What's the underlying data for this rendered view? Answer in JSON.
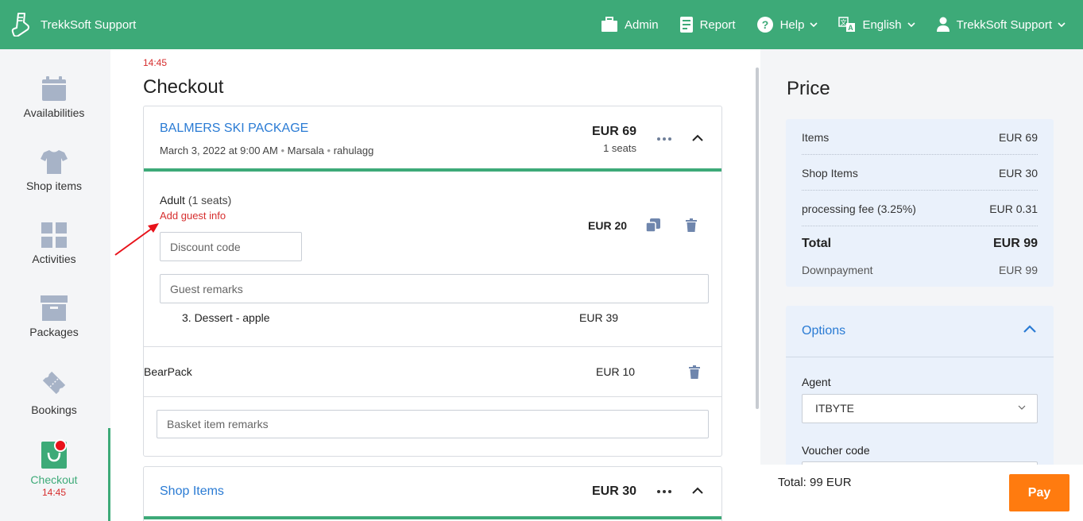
{
  "topbar": {
    "brand": "TrekkSoft Support",
    "nav": {
      "admin": "Admin",
      "report": "Report",
      "help": "Help",
      "language": "English",
      "user": "TrekkSoft Support"
    },
    "icons": [
      "boot-logo-icon",
      "briefcase-icon",
      "report-icon",
      "help-icon",
      "translate-icon",
      "user-icon",
      "chevron-down-icon"
    ]
  },
  "sidebar": {
    "items": [
      {
        "label": "Availabilities",
        "icon": "calendar-icon"
      },
      {
        "label": "Shop items",
        "icon": "tshirt-icon"
      },
      {
        "label": "Activities",
        "icon": "grid-icon"
      },
      {
        "label": "Packages",
        "icon": "archive-box-icon"
      },
      {
        "label": "Bookings",
        "icon": "ticket-icon"
      },
      {
        "label": "Checkout",
        "icon": "cart-icon",
        "active": true,
        "timer": "14:45"
      }
    ]
  },
  "main": {
    "timer": "14:45",
    "title": "Checkout",
    "package": {
      "name": "BALMERS SKI PACKAGE",
      "date": "March 3, 2022 at 9:00 AM",
      "location": "Marsala",
      "user": "rahulagg",
      "price": "EUR 69",
      "seats": "1 seats"
    },
    "ticket": {
      "type": "Adult",
      "seats": "(1 seats)",
      "guest_link": "Add guest info",
      "price": "EUR 20",
      "discount_placeholder": "Discount code",
      "remarks_placeholder": "Guest remarks"
    },
    "extra": {
      "name": "3. Dessert - apple",
      "price": "EUR 39"
    },
    "bearpack": {
      "name": "BearPack",
      "price": "EUR 10"
    },
    "basket_placeholder": "Basket item remarks",
    "shop_items": {
      "title": "Shop Items",
      "price": "EUR 30"
    }
  },
  "price": {
    "title": "Price",
    "rows": [
      {
        "label": "Items",
        "value": "EUR 69"
      },
      {
        "label": "Shop Items",
        "value": "EUR 30"
      },
      {
        "label": "processing fee (3.25%)",
        "value": "EUR 0.31"
      }
    ],
    "total": {
      "label": "Total",
      "value": "EUR 99"
    },
    "downpayment": {
      "label": "Downpayment",
      "value": "EUR 99"
    }
  },
  "options": {
    "title": "Options",
    "agent_label": "Agent",
    "agent_value": "ITBYTE",
    "voucher_label": "Voucher code"
  },
  "footer": {
    "total": "Total: 99 EUR",
    "pay": "Pay"
  },
  "colors": {
    "brand_green": "#3daa78",
    "link_blue": "#2a7bd4",
    "alert_red": "#d62e2e",
    "pay_orange": "#ff7b0f",
    "icon_slate": "#a7b3c7"
  }
}
